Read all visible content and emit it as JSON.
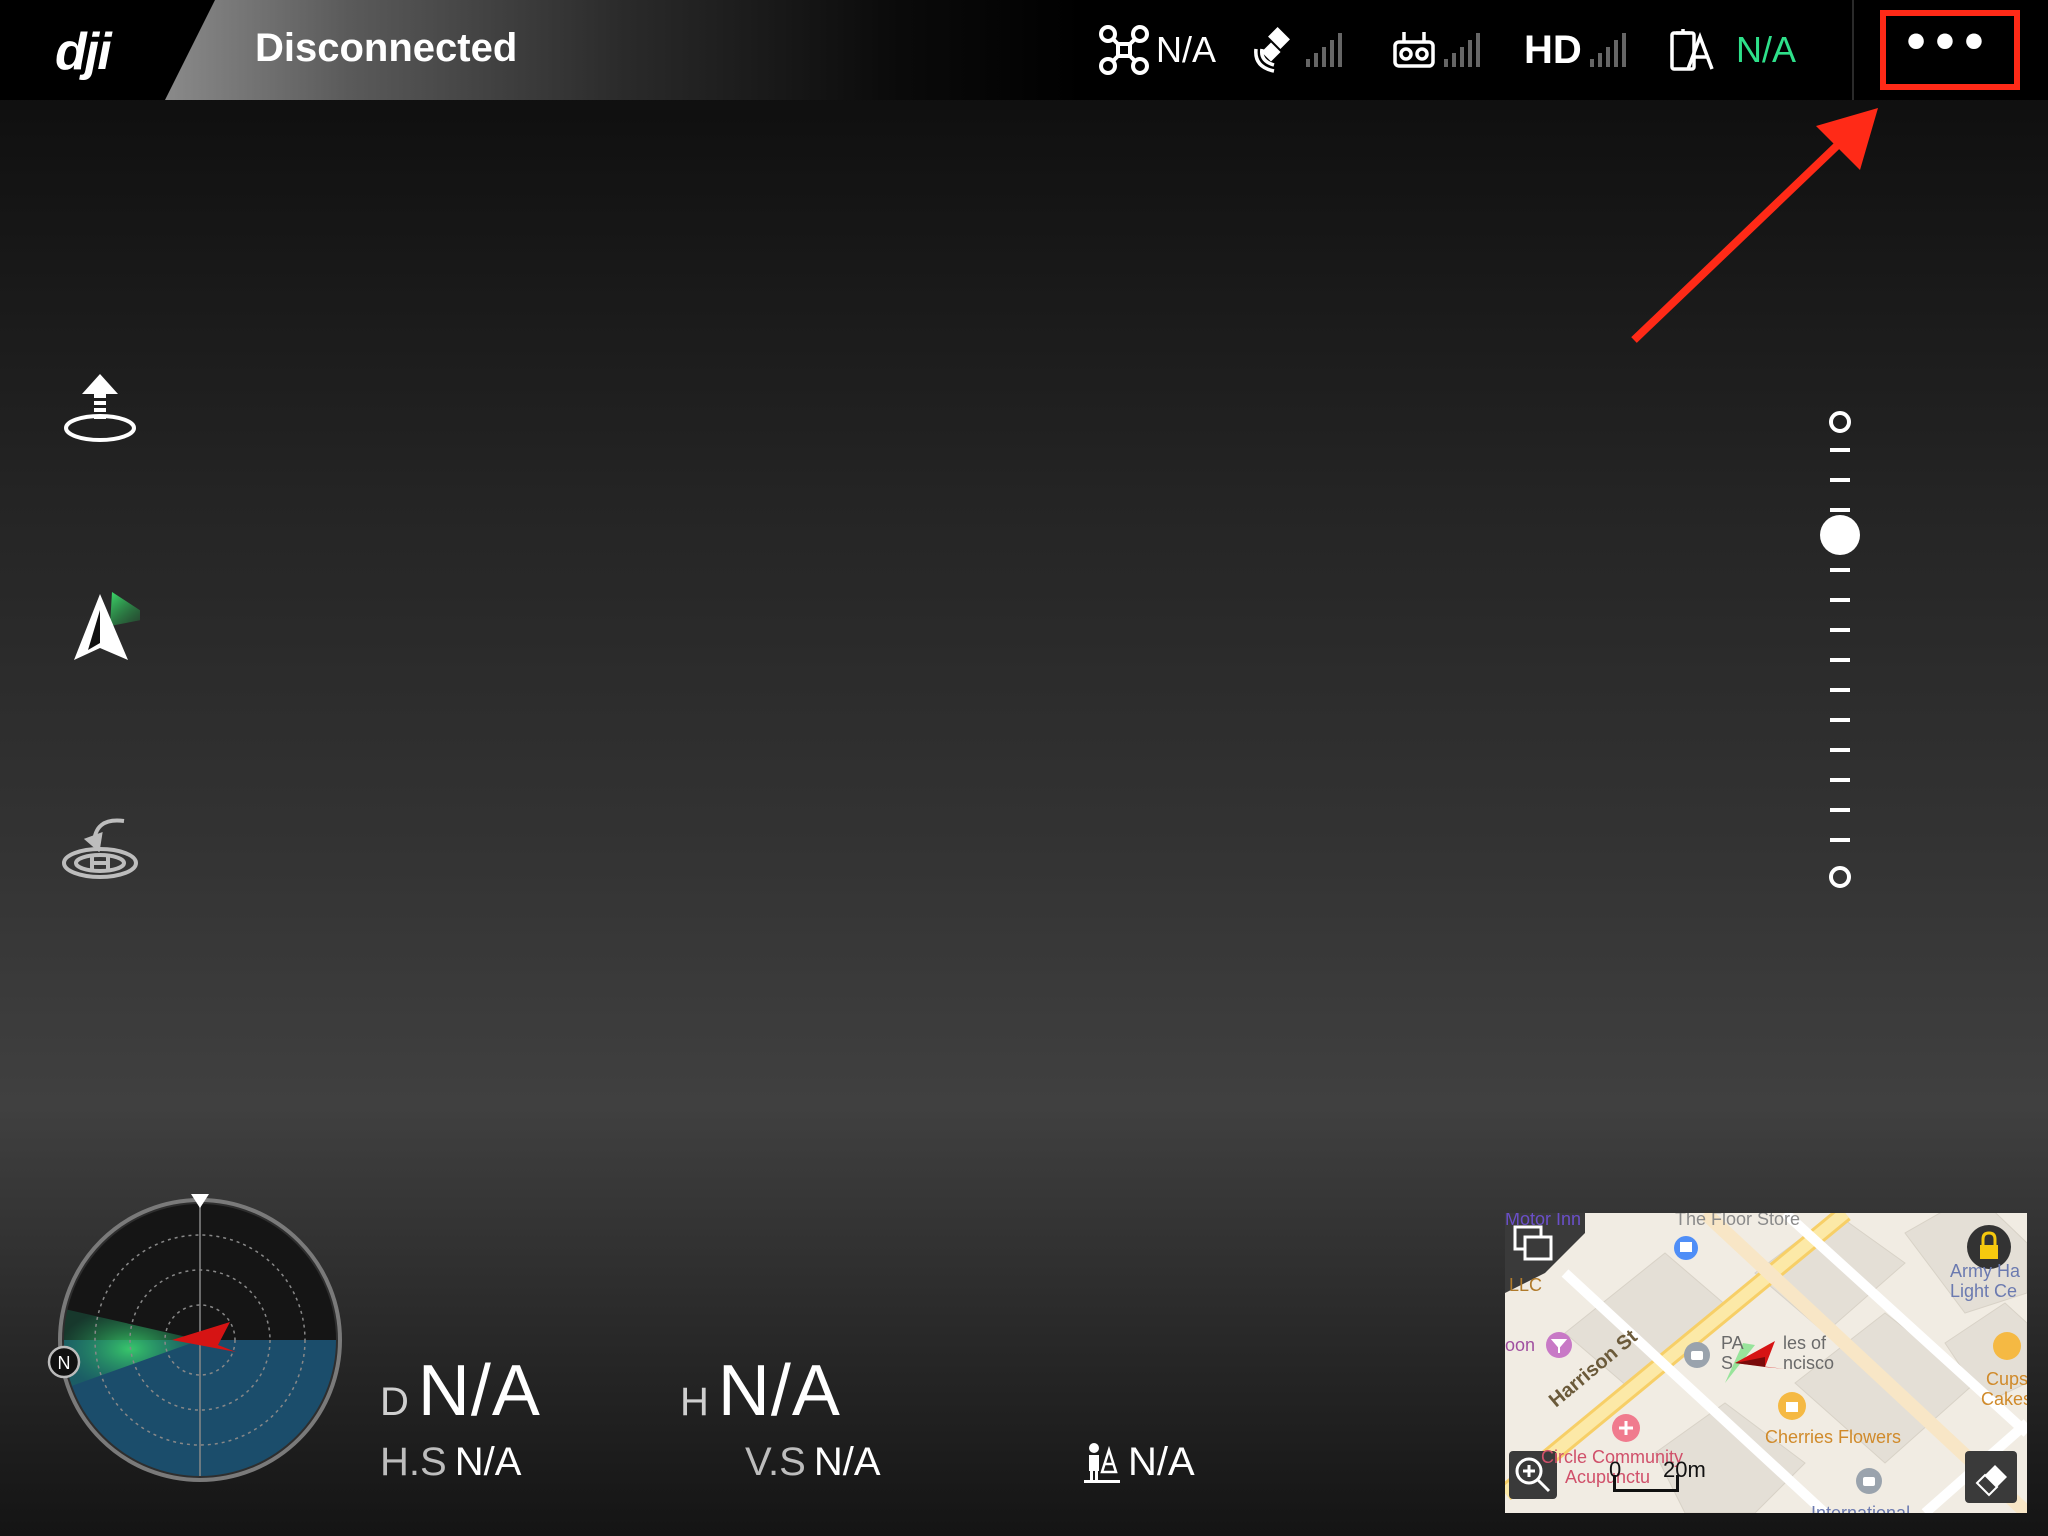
{
  "topbar": {
    "logo": "dji",
    "status": "Disconnected",
    "aircraft_value": "N/A",
    "hd_label": "HD",
    "battery_value": "N/A",
    "more_label": "•••"
  },
  "telemetry": {
    "distance_prefix": "D",
    "distance_value": "N/A",
    "height_prefix": "H",
    "height_value": "N/A",
    "hspeed_prefix": "H.S",
    "hspeed_value": "N/A",
    "vspeed_prefix": "V.S",
    "vspeed_value": "N/A",
    "home_value": "N/A"
  },
  "radar": {
    "north_label": "N"
  },
  "map": {
    "labels": {
      "motor": "Motor Inn",
      "floor": "The Floor Store",
      "llc": "LLC",
      "harrison": "Harrison St",
      "pal": "PA",
      "sf": "S",
      "les": "les of",
      "ncisco": "ncisco",
      "army": "Army Ha",
      "light": "Light Ce",
      "cups": "Cups",
      "cakes": "Cakes",
      "cherries": "Cherries Flowers",
      "circle": "Circle Community",
      "acu": "Acupunctu",
      "intl": "International",
      "on": "oon"
    },
    "scale_zero": "0",
    "scale_twenty": "20m"
  },
  "colors": {
    "accent_red": "#ff2a17",
    "status_green": "#2ee08a"
  }
}
